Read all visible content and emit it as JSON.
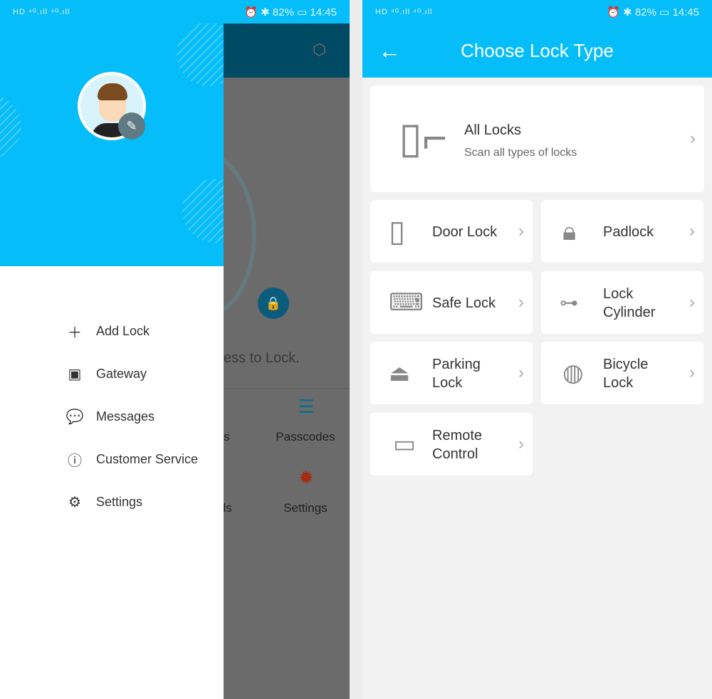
{
  "status_bar": {
    "left": "HD ⁴ᴳ.ıll ⁴ᴳ.ıll",
    "battery": "82%",
    "time": "14:45"
  },
  "left_screen": {
    "background": {
      "hint_text": "ess to Lock.",
      "items": [
        "ys",
        "Passcodes",
        "rds",
        "Settings"
      ]
    },
    "drawer": {
      "menu": [
        {
          "icon": "plus-icon",
          "label": "Add Lock"
        },
        {
          "icon": "gateway-icon",
          "label": "Gateway"
        },
        {
          "icon": "messages-icon",
          "label": "Messages"
        },
        {
          "icon": "info-icon",
          "label": "Customer Service"
        },
        {
          "icon": "gear-icon",
          "label": "Settings"
        }
      ]
    }
  },
  "right_screen": {
    "title": "Choose Lock Type",
    "all_locks": {
      "label": "All Locks",
      "subtitle": "Scan all types of locks"
    },
    "lock_types": [
      "Door Lock",
      "Padlock",
      "Safe Lock",
      "Lock Cylinder",
      "Parking Lock",
      "Bicycle Lock",
      "Remote Control"
    ]
  },
  "colors": {
    "primary": "#05bdf9",
    "overlay": "#6b6b6b",
    "app_header": "#004a63"
  }
}
